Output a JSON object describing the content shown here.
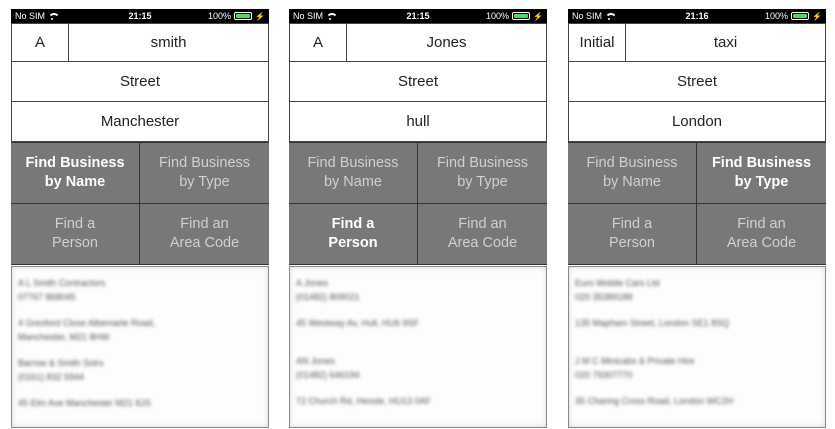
{
  "screens": [
    {
      "status": {
        "carrier": "No SIM",
        "time": "21:15",
        "battery": "100%"
      },
      "initial": "A",
      "name": "smith",
      "street": "Street",
      "town": "Manchester",
      "buttons": [
        {
          "label": "Find Business\nby Name",
          "active": true
        },
        {
          "label": "Find Business\nby Type",
          "active": false
        },
        {
          "label": "Find a\nPerson",
          "active": false
        },
        {
          "label": "Find an\nArea Code",
          "active": false
        }
      ],
      "results": [
        "A L Smith Contractors",
        "07767 868045",
        "",
        "4 Gresford Close Albemarle Road,",
        "Manchester, M21 8HW",
        "",
        "Barrow & Smith Solrs",
        "(0161) 832 5944",
        "",
        "45 Elm Ave Manchester M21 8JS"
      ]
    },
    {
      "status": {
        "carrier": "No SIM",
        "time": "21:15",
        "battery": "100%"
      },
      "initial": "A",
      "name": "Jones",
      "street": "Street",
      "town": "hull",
      "buttons": [
        {
          "label": "Find Business\nby Name",
          "active": false
        },
        {
          "label": "Find Business\nby Type",
          "active": false
        },
        {
          "label": "Find a\nPerson",
          "active": true
        },
        {
          "label": "Find an\nArea Code",
          "active": false
        }
      ],
      "results": [
        "A Jones",
        "(01482) 809021",
        "",
        "45 Westway Av, Hull, HU6 9SF",
        "",
        "",
        "AN Jones",
        "(01482) 646194",
        "",
        "72 Church Rd, Hessle, HU13 0AF"
      ]
    },
    {
      "status": {
        "carrier": "No SIM",
        "time": "21:16",
        "battery": "100%"
      },
      "initial": "Initial",
      "name": "taxi",
      "street": "Street",
      "town": "London",
      "buttons": [
        {
          "label": "Find Business\nby Name",
          "active": false
        },
        {
          "label": "Find Business\nby Type",
          "active": true
        },
        {
          "label": "Find a\nPerson",
          "active": false
        },
        {
          "label": "Find an\nArea Code",
          "active": false
        }
      ],
      "results": [
        "Euro Mobile Cars Ltd",
        "020 35389188",
        "",
        "135 Mapham Street, London SE1 8SQ",
        "",
        "",
        "J M C Minicabs & Private Hire",
        "020 79307770",
        "",
        "35 Charing Cross Road, London WC2H"
      ]
    }
  ]
}
